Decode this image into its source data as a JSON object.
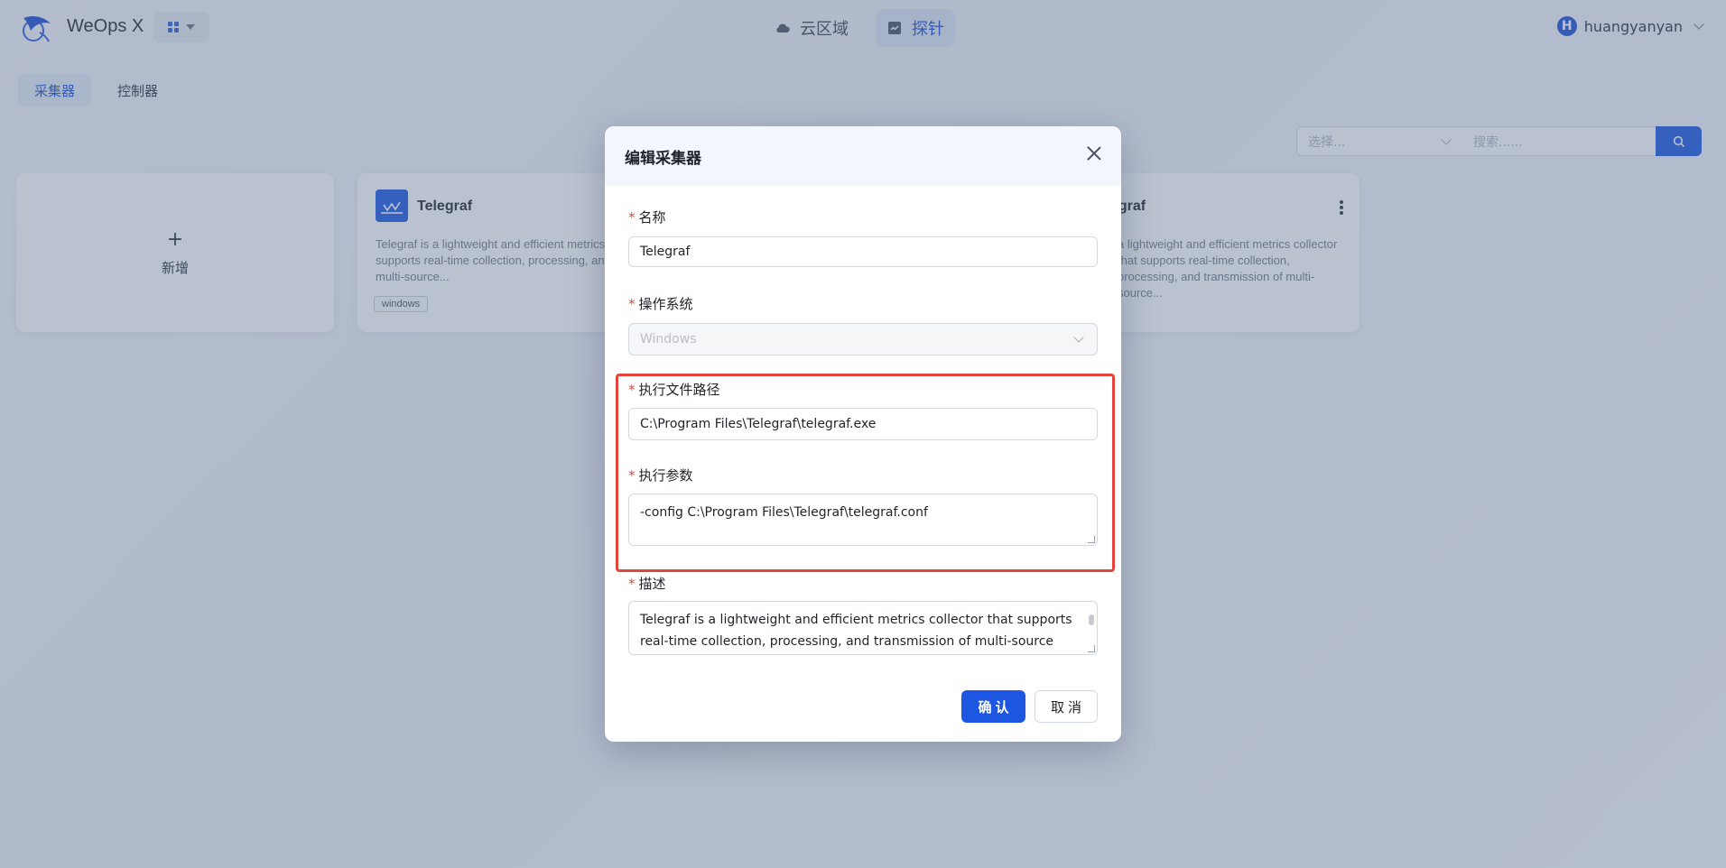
{
  "header": {
    "brand": "WeOps X",
    "nav": [
      {
        "label": "云区域",
        "icon": "cloud-icon"
      },
      {
        "label": "探针",
        "icon": "probe-icon"
      }
    ],
    "user": {
      "initial": "H",
      "name": "huangyanyan"
    }
  },
  "tabs": [
    {
      "label": "采集器",
      "active": true
    },
    {
      "label": "控制器",
      "active": false
    }
  ],
  "filter": {
    "select_placeholder": "选择...",
    "search_placeholder": "搜索......"
  },
  "cards": {
    "add_label": "新增",
    "items": [
      {
        "title": "Telegraf",
        "desc": "Telegraf is a lightweight and efficient metrics collector that supports real-time collection, processing, and transmission of multi-source...",
        "tag": "windows"
      },
      {
        "title": "egraf",
        "desc": "a lightweight and efficient metrics collector that supports real-time collection, processing, and transmission of multi-source..."
      }
    ]
  },
  "modal": {
    "title": "编辑采集器",
    "fields": {
      "name_label": "名称",
      "name_value": "Telegraf",
      "os_label": "操作系统",
      "os_value": "Windows",
      "path_label": "执行文件路径",
      "path_value": "C:\\Program Files\\Telegraf\\telegraf.exe",
      "args_label": "执行参数",
      "args_value": "-config C:\\Program Files\\Telegraf\\telegraf.conf",
      "desc_label": "描述",
      "desc_value": "Telegraf is a lightweight and efficient metrics collector that supports real-time collection, processing, and transmission of multi-source data,"
    },
    "buttons": {
      "ok": "确认",
      "cancel": "取消"
    }
  },
  "colors": {
    "accent": "#1d56e0",
    "required": "#e5443c",
    "highlight": "#e5443c"
  }
}
